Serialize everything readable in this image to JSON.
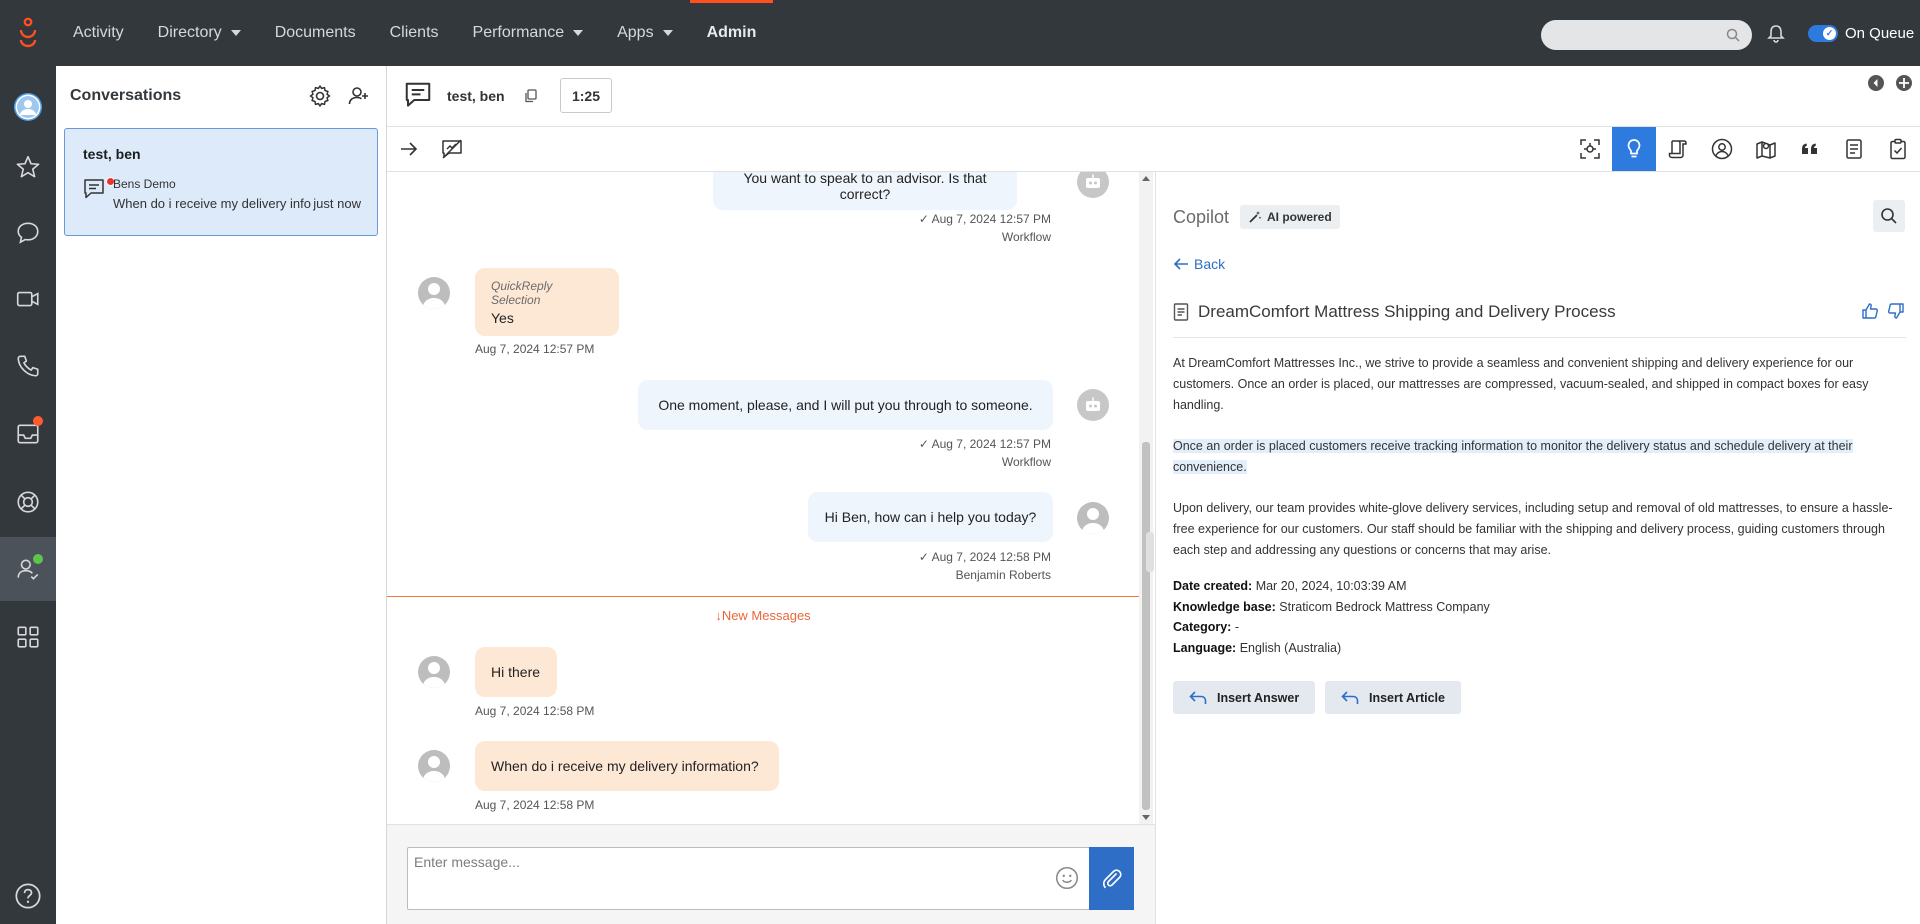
{
  "nav": {
    "items": [
      {
        "label": "Activity",
        "caret": false
      },
      {
        "label": "Directory",
        "caret": true
      },
      {
        "label": "Documents",
        "caret": false
      },
      {
        "label": "Clients",
        "caret": false
      },
      {
        "label": "Performance",
        "caret": true
      },
      {
        "label": "Apps",
        "caret": true
      },
      {
        "label": "Admin",
        "caret": false,
        "active": true
      }
    ],
    "search_placeholder": "",
    "queue_label": "On Queue",
    "accent": "#ff4f1f"
  },
  "conversations": {
    "title": "Conversations",
    "items": [
      {
        "name": "test, ben",
        "from": "Bens Demo",
        "preview": "When do i receive my delivery info",
        "time": "just now"
      }
    ]
  },
  "interaction": {
    "name": "test, ben",
    "timer": "1:25"
  },
  "chat": {
    "messages": [
      {
        "text": "You want to speak to an advisor. Is that correct?",
        "time": "Aug 7, 2024 12:57 PM",
        "sender": "Workflow"
      },
      {
        "label": "QuickReply Selection",
        "text": "Yes",
        "time": "Aug 7, 2024 12:57 PM"
      },
      {
        "text": "One moment, please, and I will put you through to someone.",
        "time": "Aug 7, 2024 12:57 PM",
        "sender": "Workflow"
      },
      {
        "text": "Hi Ben, how can i help you today?",
        "time": "Aug 7, 2024 12:58 PM",
        "sender": "Benjamin Roberts"
      },
      {
        "text": "Hi there",
        "time": "Aug 7, 2024 12:58 PM"
      },
      {
        "text": "When do i receive my delivery information?",
        "time": "Aug 7, 2024 12:58 PM"
      }
    ],
    "new_messages": "New Messages",
    "composer_placeholder": "Enter message..."
  },
  "copilot": {
    "title": "Copilot",
    "badge": "AI powered",
    "back": "Back",
    "article_title": "DreamComfort Mattress Shipping and Delivery Process",
    "paragraphs": [
      "At DreamComfort Mattresses Inc., we strive to provide a seamless and convenient shipping and delivery experience for our customers. Once an order is placed, our mattresses are compressed, vacuum-sealed, and shipped in compact boxes for easy handling.",
      "Once an order is placed customers receive tracking information to monitor the delivery status and schedule delivery at their convenience.",
      "Upon delivery, our team provides white-glove delivery services, including setup and removal of old mattresses, to ensure a hassle-free experience for our customers. Our staff should be familiar with the shipping and delivery process, guiding customers through each step and addressing any questions or concerns that may arise."
    ],
    "meta": [
      {
        "label": "Date created:",
        "value": "Mar 20, 2024, 10:03:39 AM"
      },
      {
        "label": "Knowledge base:",
        "value": "Straticom Bedrock Mattress Company"
      },
      {
        "label": "Category:",
        "value": "-"
      },
      {
        "label": "Language:",
        "value": "English (Australia)"
      }
    ],
    "insert_answer": "Insert Answer",
    "insert_article": "Insert Article"
  }
}
